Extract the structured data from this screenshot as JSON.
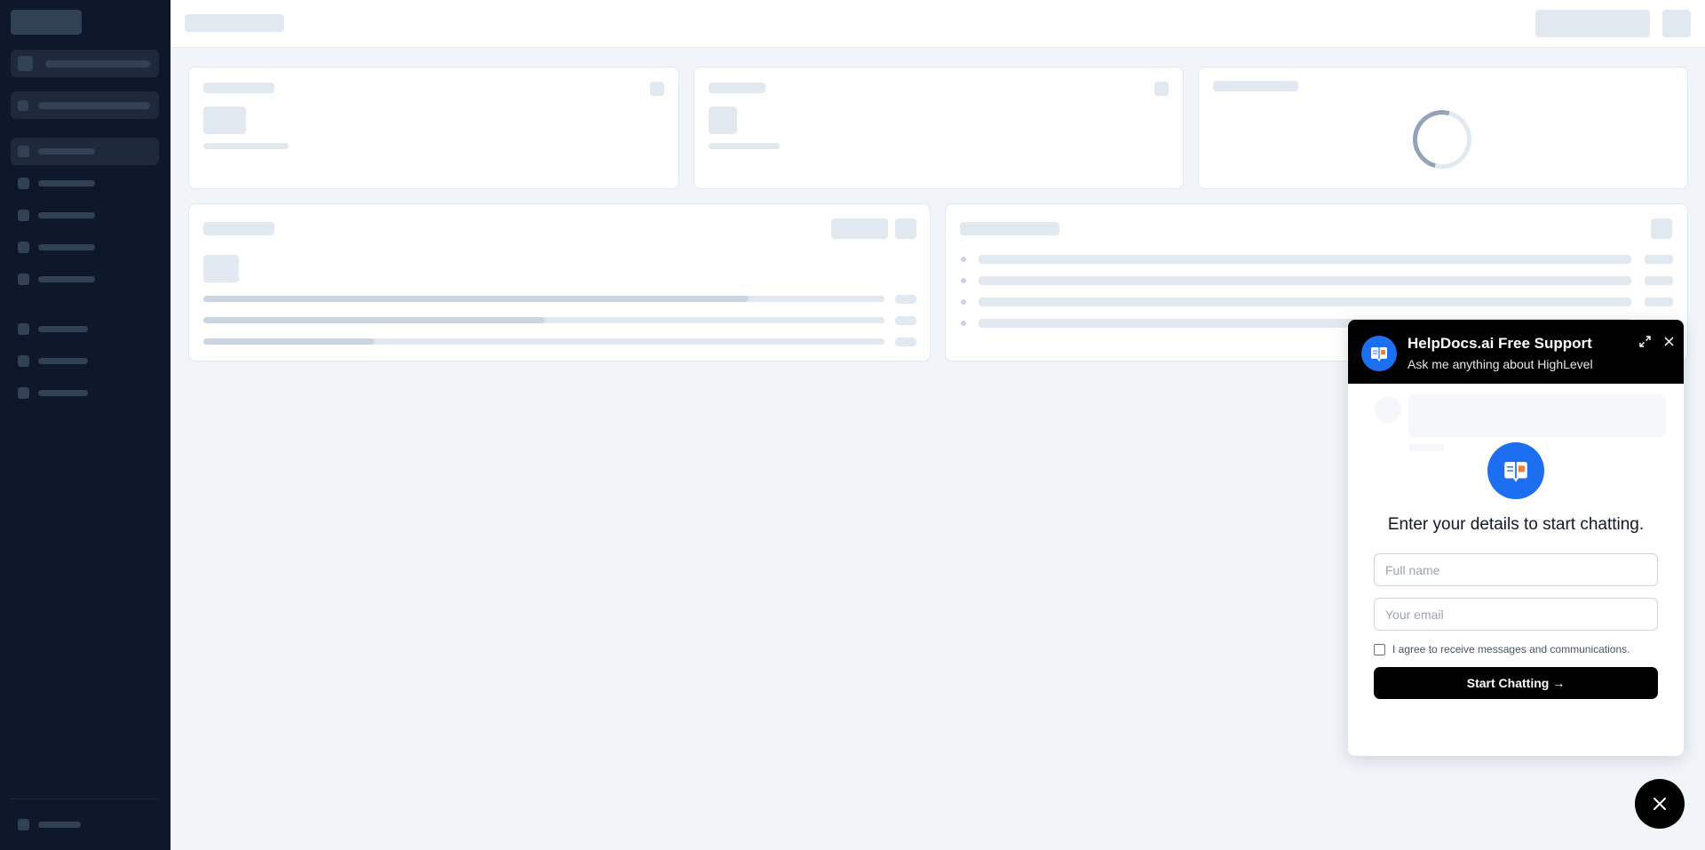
{
  "chat": {
    "title": "HelpDocs.ai Free Support",
    "subtitle": "Ask me anything about HighLevel",
    "prompt": "Enter your details to start chatting.",
    "full_name_placeholder": "Full name",
    "email_placeholder": "Your email",
    "agree_label": "I agree to receive messages and communications.",
    "agree_checked": false,
    "start_button_label": "Start Chatting →",
    "header_icons": [
      "expand-icon",
      "close-icon"
    ],
    "avatar_icon": "book-chat-icon",
    "brand_color": "#1d6ff2"
  },
  "loading_skeleton": {
    "progress_bars": [
      0.8,
      0.5,
      0.25
    ]
  },
  "fab": {
    "icon": "close-icon"
  }
}
